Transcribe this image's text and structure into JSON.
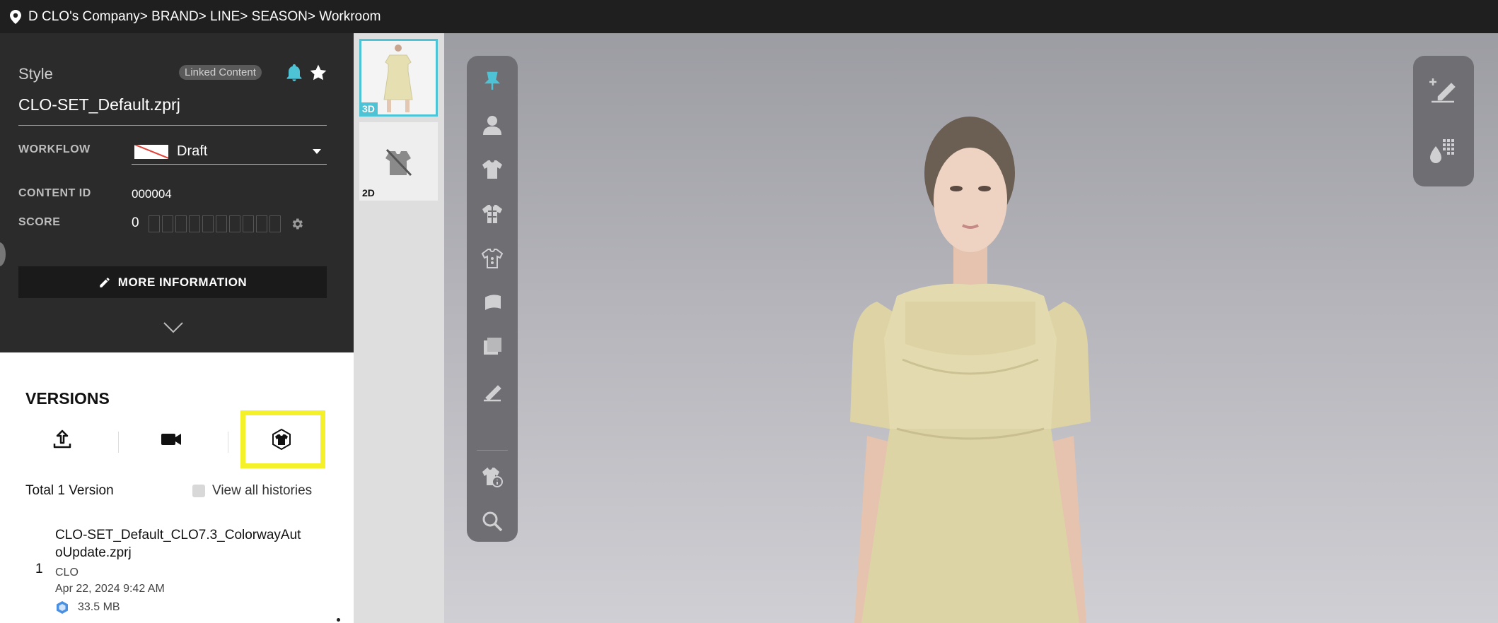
{
  "breadcrumb": "D CLO's Company> BRAND> LINE> SEASON> Workroom",
  "style": {
    "label": "Style",
    "linked_badge": "Linked Content",
    "filename": "CLO-SET_Default.zprj"
  },
  "workflow": {
    "label": "WORKFLOW",
    "value": "Draft"
  },
  "content_id": {
    "label": "CONTENT ID",
    "value": "000004"
  },
  "score": {
    "label": "SCORE",
    "value": "0",
    "max_boxes": 10
  },
  "more_info_label": "MORE INFORMATION",
  "versions": {
    "title": "VERSIONS",
    "total": "Total 1 Version",
    "view_all": "View all histories",
    "items": [
      {
        "number": "1",
        "name": "CLO-SET_Default_CLO7.3_ColorwayAutoUpdate.zprj",
        "author": "CLO",
        "date": "Apr 22, 2024 9:42 AM",
        "size": "33.5 MB"
      }
    ]
  },
  "thumbnails": {
    "tag_3d": "3D",
    "tag_2d": "2D"
  },
  "colors": {
    "accent_cyan": "#4fc3d6",
    "highlight_yellow": "#f4f12a",
    "workflow_red": "#e0443a"
  },
  "toolbar_icons": [
    "pin-icon",
    "avatar-icon",
    "garment-icon",
    "fabric-icon",
    "trim-icon",
    "material-icon",
    "colorway-icon",
    "measure-icon",
    "garment-info-icon",
    "zoom-icon"
  ],
  "right_toolbar_icons": [
    "annotation-icon",
    "color-swatch-icon"
  ]
}
